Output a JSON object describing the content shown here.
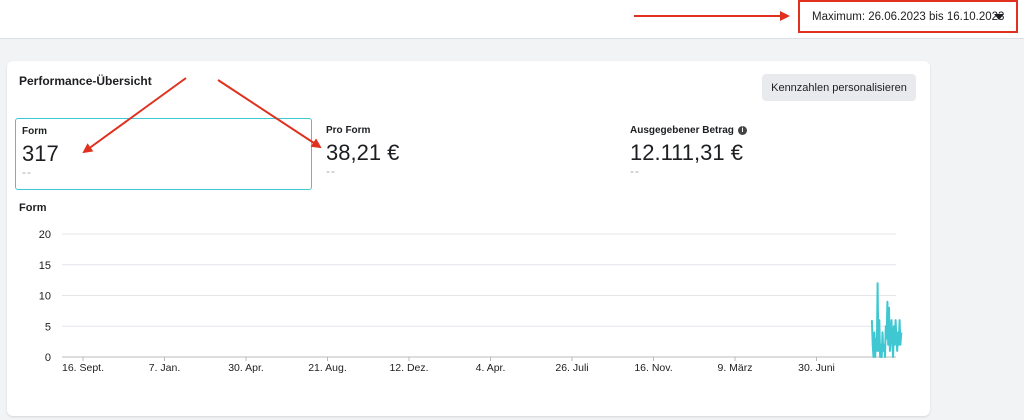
{
  "header": {
    "date_range_label": "Maximum: 26.06.2023 bis 16.10.2023",
    "caret_icon": "caret-down-icon"
  },
  "card": {
    "title": "Performance-Übersicht",
    "personalize_button": "Kennzahlen personalisieren"
  },
  "metrics": [
    {
      "label": "Form",
      "value": "317",
      "compare": "--",
      "selected": true
    },
    {
      "label": "Pro Form",
      "value": "38,21 €",
      "compare": "--",
      "selected": false
    },
    {
      "label": "Ausgegebener Betrag",
      "value": "12.111,31 €",
      "compare": "--",
      "selected": false,
      "info_icon": "info-icon"
    }
  ],
  "annotation_color": "#e0301e",
  "series_color": "#3fc7d2",
  "chart_data": {
    "type": "line",
    "title": "Form",
    "y_ticks": [
      0,
      5,
      10,
      15,
      20
    ],
    "ylim": [
      0,
      20
    ],
    "x_tick_labels": [
      "16. Sept.",
      "7. Jan.",
      "30. Apr.",
      "21. Aug.",
      "12. Dez.",
      "4. Apr.",
      "26. Juli",
      "16. Nov.",
      "9. März",
      "30. Juni"
    ],
    "grid": true,
    "series": [
      {
        "values": [
          [
            9.68,
            6
          ],
          [
            9.69,
            2
          ],
          [
            9.7,
            0
          ],
          [
            9.71,
            4
          ],
          [
            9.72,
            0
          ],
          [
            9.73,
            3
          ],
          [
            9.74,
            1
          ],
          [
            9.75,
            12
          ],
          [
            9.76,
            1
          ],
          [
            9.77,
            6
          ],
          [
            9.78,
            0
          ],
          [
            9.79,
            2
          ],
          [
            9.8,
            0
          ],
          [
            9.81,
            4
          ],
          [
            9.82,
            1
          ],
          [
            9.83,
            2
          ],
          [
            9.84,
            0
          ],
          [
            9.85,
            5
          ],
          [
            9.86,
            3
          ],
          [
            9.87,
            9
          ],
          [
            9.88,
            2
          ],
          [
            9.89,
            8
          ],
          [
            9.9,
            1
          ],
          [
            9.91,
            4
          ],
          [
            9.92,
            6
          ],
          [
            9.93,
            2
          ],
          [
            9.94,
            0
          ],
          [
            9.95,
            5
          ],
          [
            9.96,
            2
          ],
          [
            9.97,
            6
          ],
          [
            9.98,
            3
          ],
          [
            9.99,
            1
          ],
          [
            10.0,
            4
          ],
          [
            10.01,
            2
          ],
          [
            10.02,
            6
          ],
          [
            10.03,
            2
          ],
          [
            10.04,
            4
          ],
          [
            10.56,
            13
          ],
          [
            10.57,
            12
          ],
          [
            10.58,
            10
          ],
          [
            10.59,
            12
          ],
          [
            10.6,
            8
          ],
          [
            10.61,
            12
          ],
          [
            10.62,
            9
          ],
          [
            10.63,
            12
          ],
          [
            10.64,
            4
          ],
          [
            10.65,
            2
          ],
          [
            10.66,
            12
          ],
          [
            10.67,
            2
          ]
        ]
      }
    ]
  }
}
